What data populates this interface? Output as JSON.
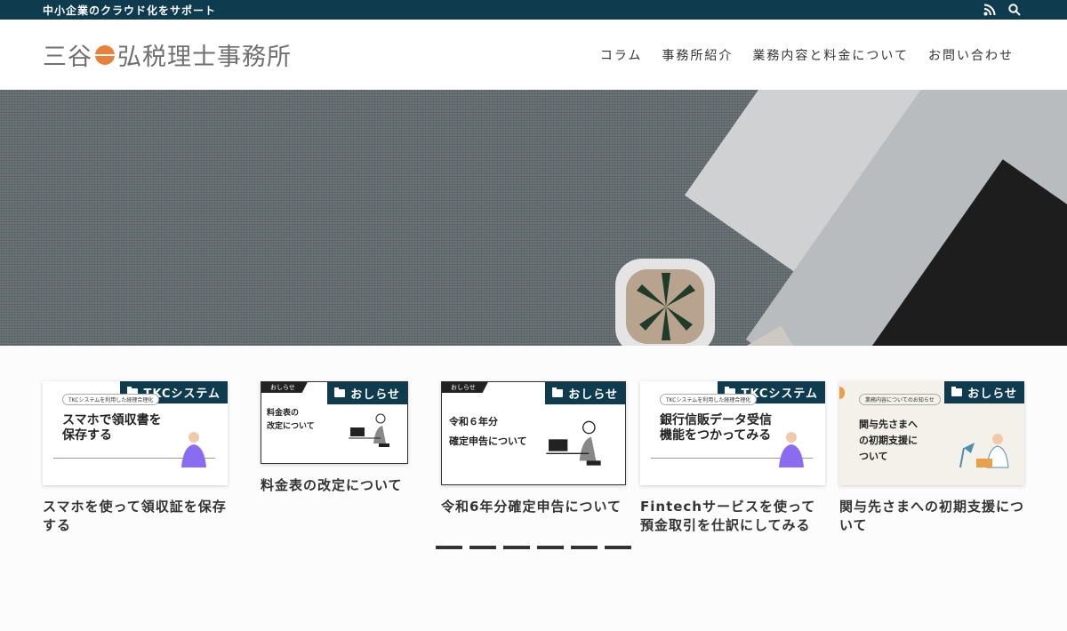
{
  "topbar": {
    "tagline": "中小企業のクラウド化をサポート",
    "icons": [
      "rss-icon",
      "search-icon"
    ]
  },
  "header": {
    "logo_text_left": "三谷",
    "logo_text_right": "弘税理士事務所",
    "nav": [
      "コラム",
      "事務所紹介",
      "業務内容と料金について",
      "お問い合わせ"
    ]
  },
  "cards": [
    {
      "category": "TKCシステム",
      "tag": "TKCシステムを利用した経理合理化",
      "headline": "スマホで領収書を\n保存する",
      "title": "スマホを使って領収証を保存する"
    },
    {
      "category": "おしらせ",
      "tag": "おしらせ",
      "headline": "料金表の\n改定について",
      "title": "料金表の改定について"
    },
    {
      "category": "おしらせ",
      "tag": "おしらせ",
      "headline": "令和６年分\n確定申告について",
      "title": "令和6年分確定申告について"
    },
    {
      "category": "TKCシステム",
      "tag": "TKCシステムを利用した経理合理化",
      "headline": "銀行信販データ受信\n機能をつかってみる",
      "title": "Fintechサービスを使って預金取引を仕訳にしてみる"
    },
    {
      "category": "おしらせ",
      "tag": "業務内容についてのお知らせ",
      "headline": "関与先さまへ\nの初期支援に\nついて",
      "title": "関与先さまへの初期支援について"
    }
  ],
  "colors": {
    "topbar": "#0f3b4f",
    "accent": "#e8813b",
    "person": "#8a6cf0"
  }
}
